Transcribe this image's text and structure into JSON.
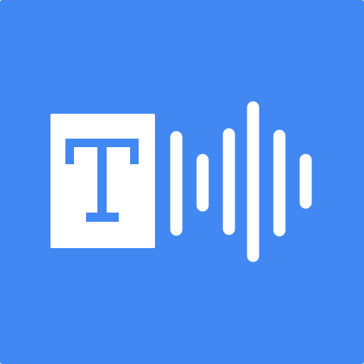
{
  "icon": {
    "name": "text-to-speech-icon",
    "background_color": "#4188F3",
    "foreground_color": "#FFFFFF",
    "glyph_color": "#4188F3",
    "text_glyph": "T",
    "waveform_level_count": 6
  }
}
